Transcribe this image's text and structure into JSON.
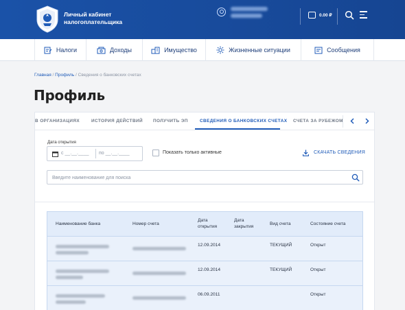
{
  "header": {
    "brand_line1": "Личный кабинет",
    "brand_line2": "налогоплательщика",
    "balance": "0.00 ₽"
  },
  "nav": {
    "items": [
      {
        "label": "Налоги",
        "icon": "taxes-icon"
      },
      {
        "label": "Доходы",
        "icon": "income-icon"
      },
      {
        "label": "Имущество",
        "icon": "property-icon"
      },
      {
        "label": "Жизненные ситуации",
        "icon": "life-situations-icon"
      },
      {
        "label": "Сообщения",
        "icon": "messages-icon"
      }
    ]
  },
  "breadcrumb": {
    "home": "Главная",
    "sep": " / ",
    "profile": "Профиль",
    "current": "Сведения о банковских счетах"
  },
  "page": {
    "title": "Профиль"
  },
  "tabs": [
    {
      "label": "В ОРГАНИЗАЦИЯХ",
      "active": false
    },
    {
      "label": "ИСТОРИЯ ДЕЙСТВИЙ",
      "active": false
    },
    {
      "label": "ПОЛУЧИТЬ ЭП",
      "active": false
    },
    {
      "label": "СВЕДЕНИЯ О БАНКОВСКИХ СЧЕТАХ",
      "active": true
    },
    {
      "label": "СЧЕТА ЗА РУБЕЖОМ",
      "active": false
    }
  ],
  "filters": {
    "date_label": "Дата открытия",
    "date_from": "с __.__.____",
    "date_to": "по __.__.____",
    "only_active_label": "Показать только активные",
    "download_label": "СКАЧАТЬ СВЕДЕНИЯ",
    "search_placeholder": "Введите наименование для поиска"
  },
  "table": {
    "columns": [
      "Наименование банка",
      "Номер счета",
      "Дата открытия",
      "Дата закрытия",
      "Вид счета",
      "Состояние счета"
    ],
    "rows": [
      {
        "open_date": "12.09.2014",
        "close_date": "",
        "type": "ТЕКУЩИЙ",
        "status": "Открыт"
      },
      {
        "open_date": "12.09.2014",
        "close_date": "",
        "type": "ТЕКУЩИЙ",
        "status": "Открыт"
      },
      {
        "open_date": "06.09.2011",
        "close_date": "",
        "type": "",
        "status": "Открыт"
      }
    ]
  }
}
